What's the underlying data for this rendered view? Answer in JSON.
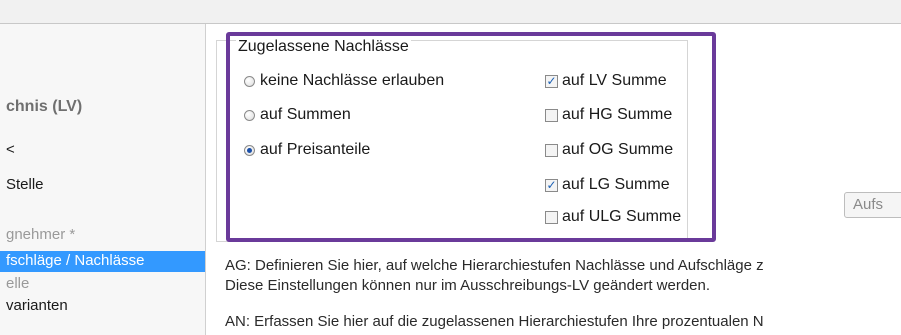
{
  "left_panel": {
    "heading": "chnis (LV)",
    "items": [
      {
        "label": "<",
        "style": "normal"
      },
      {
        "label": "Stelle",
        "style": "normal"
      },
      {
        "label": "gnehmer *",
        "style": "gray"
      },
      {
        "label": "fschläge / Nachlässe",
        "style": "selected"
      },
      {
        "label": "elle",
        "style": "gray"
      },
      {
        "label": "varianten",
        "style": "normal"
      }
    ]
  },
  "discounts_group": {
    "title": "Zugelassene Nachlässe",
    "radio_options": [
      {
        "label": "keine Nachlässe erlauben",
        "selected": false
      },
      {
        "label": "auf Summen",
        "selected": false
      },
      {
        "label": "auf Preisanteile",
        "selected": true
      }
    ],
    "check_options": [
      {
        "label": "auf LV Summe",
        "checked": true
      },
      {
        "label": "auf HG Summe",
        "checked": false
      },
      {
        "label": "auf OG Summe",
        "checked": false
      },
      {
        "label": "auf LG Summe",
        "checked": true
      },
      {
        "label": "auf ULG Summe",
        "checked": false
      }
    ]
  },
  "aufs_button": {
    "label": "Aufs"
  },
  "info_text": {
    "ag_line1": "AG: Definieren Sie hier, auf welche Hierarchiestufen Nachlässe und Aufschläge z",
    "ag_line2": "Diese Einstellungen können nur im Ausschreibungs-LV geändert werden.",
    "an_line1": "AN: Erfassen Sie hier auf die zugelassenen Hierarchiestufen Ihre prozentualen N"
  },
  "colors": {
    "highlight_border": "#6a3a9a",
    "selection": "#3399ff"
  }
}
